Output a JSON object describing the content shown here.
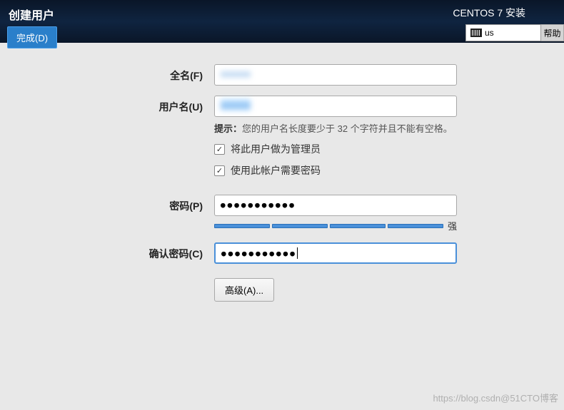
{
  "header": {
    "page_title": "创建用户",
    "done_button": "完成(D)",
    "installer_title": "CENTOS 7 安装",
    "keyboard_layout": "us",
    "help_button": "帮助"
  },
  "form": {
    "fullname": {
      "label": "全名(F)",
      "value": ""
    },
    "username": {
      "label": "用户名(U)",
      "value": "",
      "hint_label": "提示：",
      "hint_text": "您的用户名长度要少于 32 个字符并且不能有空格。"
    },
    "make_admin": {
      "label": "将此用户做为管理员",
      "checked": true
    },
    "require_password": {
      "label": "使用此帐户需要密码",
      "checked": true
    },
    "password": {
      "label": "密码(P)",
      "value": "●●●●●●●●●●●",
      "strength_text": "强"
    },
    "confirm_password": {
      "label": "确认密码(C)",
      "value": "●●●●●●●●●●●"
    },
    "advanced_button": "高级(A)..."
  },
  "watermark": "https://blog.csdn@51CTO博客"
}
